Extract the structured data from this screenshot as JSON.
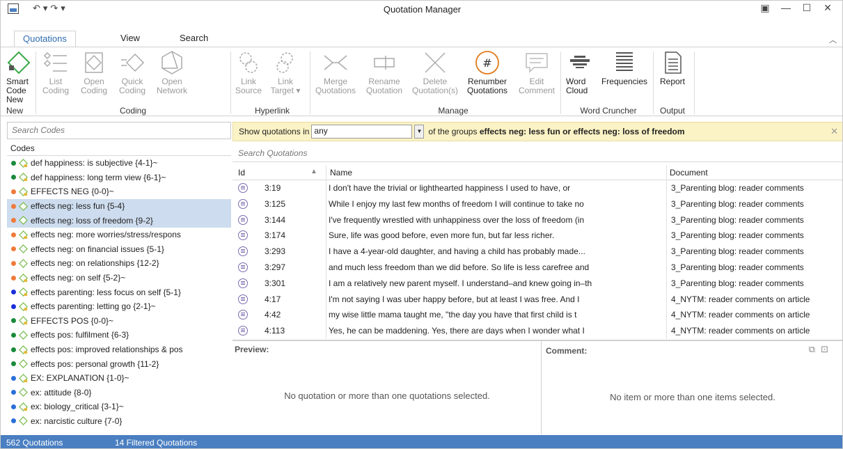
{
  "window": {
    "title": "Quotation Manager"
  },
  "tabs": [
    "Quotations",
    "View",
    "Search"
  ],
  "ribbon": {
    "smart_code": "Smart\nCode\nNew",
    "buttons": {
      "list_coding": "List\nCoding",
      "open_coding": "Open\nCoding",
      "quick_coding": "Quick\nCoding",
      "open_network": "Open\nNetwork",
      "link_source": "Link\nSource",
      "link_target": "Link\nTarget ▾",
      "merge": "Merge\nQuotations",
      "rename": "Rename\nQuotation",
      "delete": "Delete\nQuotation(s)",
      "renumber": "Renumber\nQuotations",
      "edit_comment": "Edit\nComment",
      "word_cloud": "Word\nCloud",
      "frequencies": "Frequencies",
      "report": "Report"
    },
    "groups": {
      "new": "New",
      "coding": "Coding",
      "hyperlink": "Hyperlink",
      "manage": "Manage",
      "word_cruncher": "Word Cruncher",
      "output": "Output"
    }
  },
  "left": {
    "search_placeholder": "Search Codes",
    "header": "Codes",
    "codes": [
      {
        "label": "def happiness: is subjective {4-1}~",
        "color": "#1a8a3a",
        "folder": true
      },
      {
        "label": "def happiness: long term view {6-1}~",
        "color": "#1a8a3a",
        "folder": true
      },
      {
        "label": "EFFECTS NEG {0-0}~",
        "color": "#f07a3a",
        "folder": true
      },
      {
        "label": "effects neg: less fun {5-4}",
        "color": "#f07a3a",
        "folder": false,
        "selected": true
      },
      {
        "label": "effects neg: loss of freedom {9-2}",
        "color": "#f07a3a",
        "folder": false,
        "selected": true
      },
      {
        "label": "effects neg: more worries/stress/respons",
        "color": "#f07a3a",
        "folder": true
      },
      {
        "label": "effects neg: on financial issues {5-1}",
        "color": "#f07a3a",
        "folder": false
      },
      {
        "label": "effects neg: on relationships {12-2}",
        "color": "#f07a3a",
        "folder": false
      },
      {
        "label": "effects neg: on self {5-2}~",
        "color": "#f07a3a",
        "folder": true
      },
      {
        "label": "effects parenting: less focus on self {5-1}",
        "color": "#1a2fd8",
        "folder": true
      },
      {
        "label": "effects parenting: letting go {2-1}~",
        "color": "#1a2fd8",
        "folder": true
      },
      {
        "label": "EFFECTS POS {0-0}~",
        "color": "#1a8a3a",
        "folder": true
      },
      {
        "label": "effects pos: fulfilment {6-3}",
        "color": "#1a8a3a",
        "folder": false
      },
      {
        "label": "effects pos: improved relationships & pos",
        "color": "#1a8a3a",
        "folder": true
      },
      {
        "label": "effects pos: personal growth {11-2}",
        "color": "#1a8a3a",
        "folder": false
      },
      {
        "label": "EX:  EXPLANATION {1-0}~",
        "color": "#2a6fd8",
        "folder": true
      },
      {
        "label": "ex: attitude {8-0}",
        "color": "#2a6fd8",
        "folder": false
      },
      {
        "label": "ex: biology_critical {3-1}~",
        "color": "#2a6fd8",
        "folder": true
      },
      {
        "label": "ex: narcistic culture {7-0}",
        "color": "#2a6fd8",
        "folder": false
      }
    ]
  },
  "filter": {
    "prefix": "Show quotations in",
    "select_value": "any",
    "middle": "of the groups",
    "groups": "effects neg: less fun or effects neg: loss of freedom"
  },
  "quotations": {
    "search_placeholder": "Search Quotations",
    "columns": [
      "Id",
      "Name",
      "Document"
    ],
    "rows": [
      {
        "id": "3:19",
        "name": "I don't have the trivial or lighthearted happiness I used to have, or",
        "doc": "3_Parenting blog: reader comments"
      },
      {
        "id": "3:125",
        "name": "While I enjoy my last few months of freedom I will continue to take no",
        "doc": "3_Parenting blog: reader comments"
      },
      {
        "id": "3:144",
        "name": "I've frequently wrestled with unhappiness over the loss of freedom (in",
        "doc": "3_Parenting blog: reader comments"
      },
      {
        "id": "3:174",
        "name": "Sure, life was good before, even more fun, but far less richer.",
        "doc": "3_Parenting blog: reader comments"
      },
      {
        "id": "3:293",
        "name": "I have a 4-year-old daughter, and having a child has probably made...",
        "doc": "3_Parenting blog: reader comments"
      },
      {
        "id": "3:297",
        "name": "and much less freedom than we did before. So life is less carefree and",
        "doc": "3_Parenting blog: reader comments"
      },
      {
        "id": "3:301",
        "name": "I am a relatively new parent myself. I understand–and knew going in–th",
        "doc": "3_Parenting blog: reader comments"
      },
      {
        "id": "4:17",
        "name": "I'm not saying I was uber happy before, but at least I was free. And I",
        "doc": "4_NYTM: reader comments on article"
      },
      {
        "id": "4:42",
        "name": "my wise little mama taught me, \"the day you have that first child is t",
        "doc": "4_NYTM: reader comments on article"
      },
      {
        "id": "4:113",
        "name": "Yes, he can be maddening. Yes, there are days when I wonder what I",
        "doc": "4_NYTM: reader comments on article"
      }
    ]
  },
  "preview": {
    "title": "Preview:",
    "empty": "No quotation or more than one quotations selected."
  },
  "comment": {
    "title": "Comment:",
    "empty": "No item or more than one items selected."
  },
  "status": {
    "total": "562 Quotations",
    "filtered": "14 Filtered Quotations"
  }
}
